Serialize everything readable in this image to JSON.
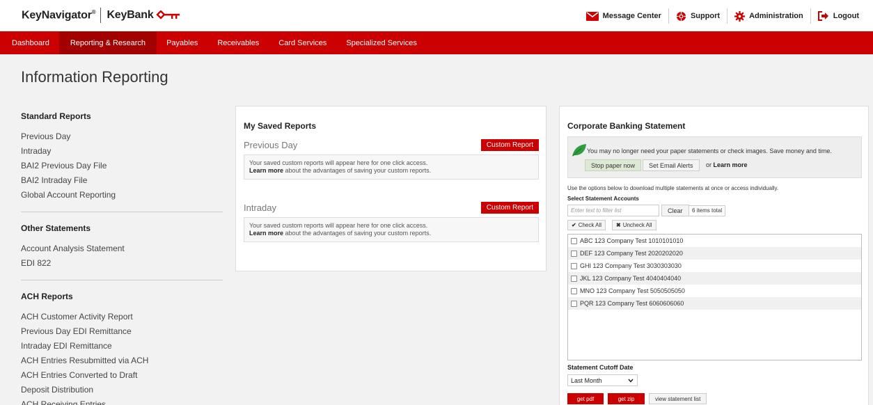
{
  "header": {
    "brand_primary": "KeyNavigator",
    "brand_reg": "®",
    "brand_secondary": "KeyBank",
    "links": [
      {
        "label": "Message Center",
        "icon": "envelope-icon"
      },
      {
        "label": "Support",
        "icon": "lifebuoy-icon"
      },
      {
        "label": "Administration",
        "icon": "gear-icon"
      },
      {
        "label": "Logout",
        "icon": "logout-icon"
      }
    ]
  },
  "nav": {
    "items": [
      "Dashboard",
      "Reporting & Research",
      "Payables",
      "Receivables",
      "Card Services",
      "Specialized Services"
    ],
    "active": "Reporting & Research"
  },
  "page_title": "Information Reporting",
  "sidebar": {
    "sections": [
      {
        "heading": "Standard Reports",
        "links": [
          "Previous Day",
          "Intraday",
          "BAI2 Previous Day File",
          "BAI2 Intraday File",
          "Global Account Reporting"
        ]
      },
      {
        "heading": "Other Statements",
        "links": [
          "Account Analysis Statement",
          "EDI 822"
        ]
      },
      {
        "heading": "ACH Reports",
        "links": [
          "ACH Customer Activity Report",
          "Previous Day EDI Remittance",
          "Intraday EDI Remittance",
          "ACH Entries Resubmitted via ACH",
          "ACH Entries Converted to Draft",
          "Deposit Distribution",
          "ACH Receiving Entries"
        ]
      }
    ]
  },
  "saved_reports": {
    "title": "My Saved Reports",
    "blocks": [
      {
        "name": "Previous Day",
        "button": "Custom Report",
        "line1": "Your saved custom reports will appear here for one click access.",
        "learn_more": "Learn more",
        "line2": "about the advantages of saving your custom reports."
      },
      {
        "name": "Intraday",
        "button": "Custom Report",
        "line1": "Your saved custom reports will appear here for one click access.",
        "learn_more": "Learn more",
        "line2": "about the advantages of saving your custom reports."
      }
    ]
  },
  "statement": {
    "title": "Corporate Banking Statement",
    "promo_message": "You may no longer need your paper statements or check images. Save money and time.",
    "stop_paper": "Stop paper now",
    "email_alerts": "Set Email Alerts",
    "or_text": "or",
    "learn_more": "Learn more",
    "info": "Use the options below to download multiple statements at once or access individually.",
    "select_label": "Select Statement Accounts",
    "filter_placeholder": "Enter text to filter list",
    "clear": "Clear",
    "items_total": "6 items total",
    "check_all": "Check All",
    "uncheck_all": "Uncheck All",
    "accounts": [
      "ABC 123 Company Test 1010101010",
      "DEF 123 Company Test 2020202020",
      "GHI 123 Company Test 3030303030",
      "JKL 123 Company Test 4040404040",
      "MNO 123 Company Test 5050505050",
      "PQR 123 Company Test 6060606060"
    ],
    "cutoff_label": "Statement Cutoff Date",
    "cutoff_value": "Last Month",
    "get_pdf": "get pdf",
    "get_zip": "get zip",
    "view_list": "view statement list"
  },
  "colors": {
    "brand_red": "#cc0000",
    "nav_active": "#a30000",
    "leaf_green": "#2e9e3e"
  }
}
